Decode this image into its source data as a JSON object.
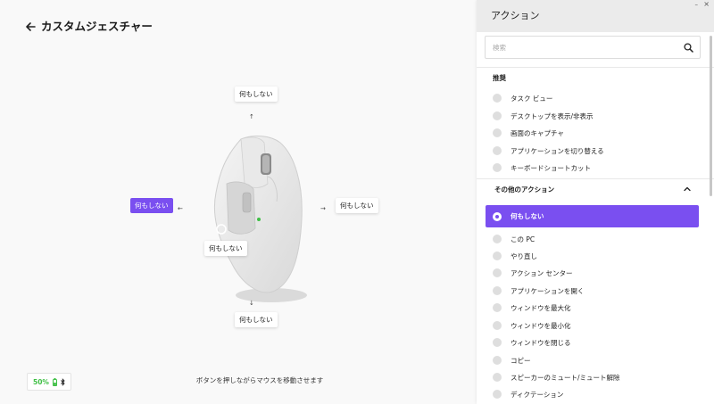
{
  "header": {
    "title": "カスタムジェスチャー"
  },
  "gestures": {
    "top": "何もしない",
    "left": "何もしない",
    "right": "何もしない",
    "center": "何もしない",
    "bottom": "何もしない"
  },
  "status": {
    "battery_percent": "50%",
    "accent_color": "#7a4ff0",
    "battery_color": "#3fbf45"
  },
  "hint": "ボタンを押しながらマウスを移動させます",
  "panel": {
    "title": "アクション",
    "search_placeholder": "検索",
    "recommended_title": "推奨",
    "recommended": [
      "タスク ビュー",
      "デスクトップを表示/非表示",
      "画面のキャプチャ",
      "アプリケーションを切り替える",
      "キーボードショートカット"
    ],
    "other_title": "その他のアクション",
    "selected": "何もしない",
    "other": [
      "この PC",
      "やり直し",
      "アクション センター",
      "アプリケーションを開く",
      "ウィンドウを最大化",
      "ウィンドウを最小化",
      "ウィンドウを閉じる",
      "コピー",
      "スピーカーのミュート/ミュート解除",
      "ディクテーション"
    ]
  }
}
